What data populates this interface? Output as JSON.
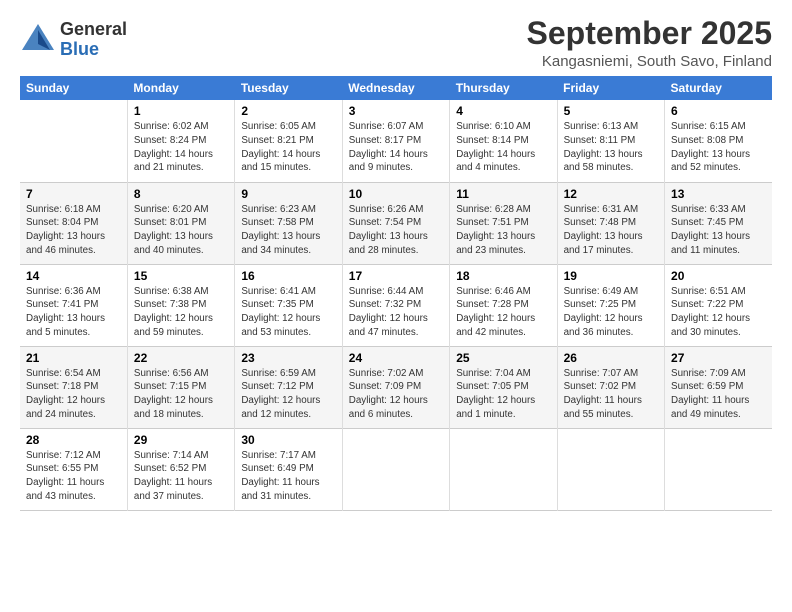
{
  "logo": {
    "general": "General",
    "blue": "Blue"
  },
  "title": "September 2025",
  "location": "Kangasniemi, South Savo, Finland",
  "days_header": [
    "Sunday",
    "Monday",
    "Tuesday",
    "Wednesday",
    "Thursday",
    "Friday",
    "Saturday"
  ],
  "weeks": [
    [
      {
        "num": "",
        "info": ""
      },
      {
        "num": "1",
        "info": "Sunrise: 6:02 AM\nSunset: 8:24 PM\nDaylight: 14 hours\nand 21 minutes."
      },
      {
        "num": "2",
        "info": "Sunrise: 6:05 AM\nSunset: 8:21 PM\nDaylight: 14 hours\nand 15 minutes."
      },
      {
        "num": "3",
        "info": "Sunrise: 6:07 AM\nSunset: 8:17 PM\nDaylight: 14 hours\nand 9 minutes."
      },
      {
        "num": "4",
        "info": "Sunrise: 6:10 AM\nSunset: 8:14 PM\nDaylight: 14 hours\nand 4 minutes."
      },
      {
        "num": "5",
        "info": "Sunrise: 6:13 AM\nSunset: 8:11 PM\nDaylight: 13 hours\nand 58 minutes."
      },
      {
        "num": "6",
        "info": "Sunrise: 6:15 AM\nSunset: 8:08 PM\nDaylight: 13 hours\nand 52 minutes."
      }
    ],
    [
      {
        "num": "7",
        "info": "Sunrise: 6:18 AM\nSunset: 8:04 PM\nDaylight: 13 hours\nand 46 minutes."
      },
      {
        "num": "8",
        "info": "Sunrise: 6:20 AM\nSunset: 8:01 PM\nDaylight: 13 hours\nand 40 minutes."
      },
      {
        "num": "9",
        "info": "Sunrise: 6:23 AM\nSunset: 7:58 PM\nDaylight: 13 hours\nand 34 minutes."
      },
      {
        "num": "10",
        "info": "Sunrise: 6:26 AM\nSunset: 7:54 PM\nDaylight: 13 hours\nand 28 minutes."
      },
      {
        "num": "11",
        "info": "Sunrise: 6:28 AM\nSunset: 7:51 PM\nDaylight: 13 hours\nand 23 minutes."
      },
      {
        "num": "12",
        "info": "Sunrise: 6:31 AM\nSunset: 7:48 PM\nDaylight: 13 hours\nand 17 minutes."
      },
      {
        "num": "13",
        "info": "Sunrise: 6:33 AM\nSunset: 7:45 PM\nDaylight: 13 hours\nand 11 minutes."
      }
    ],
    [
      {
        "num": "14",
        "info": "Sunrise: 6:36 AM\nSunset: 7:41 PM\nDaylight: 13 hours\nand 5 minutes."
      },
      {
        "num": "15",
        "info": "Sunrise: 6:38 AM\nSunset: 7:38 PM\nDaylight: 12 hours\nand 59 minutes."
      },
      {
        "num": "16",
        "info": "Sunrise: 6:41 AM\nSunset: 7:35 PM\nDaylight: 12 hours\nand 53 minutes."
      },
      {
        "num": "17",
        "info": "Sunrise: 6:44 AM\nSunset: 7:32 PM\nDaylight: 12 hours\nand 47 minutes."
      },
      {
        "num": "18",
        "info": "Sunrise: 6:46 AM\nSunset: 7:28 PM\nDaylight: 12 hours\nand 42 minutes."
      },
      {
        "num": "19",
        "info": "Sunrise: 6:49 AM\nSunset: 7:25 PM\nDaylight: 12 hours\nand 36 minutes."
      },
      {
        "num": "20",
        "info": "Sunrise: 6:51 AM\nSunset: 7:22 PM\nDaylight: 12 hours\nand 30 minutes."
      }
    ],
    [
      {
        "num": "21",
        "info": "Sunrise: 6:54 AM\nSunset: 7:18 PM\nDaylight: 12 hours\nand 24 minutes."
      },
      {
        "num": "22",
        "info": "Sunrise: 6:56 AM\nSunset: 7:15 PM\nDaylight: 12 hours\nand 18 minutes."
      },
      {
        "num": "23",
        "info": "Sunrise: 6:59 AM\nSunset: 7:12 PM\nDaylight: 12 hours\nand 12 minutes."
      },
      {
        "num": "24",
        "info": "Sunrise: 7:02 AM\nSunset: 7:09 PM\nDaylight: 12 hours\nand 6 minutes."
      },
      {
        "num": "25",
        "info": "Sunrise: 7:04 AM\nSunset: 7:05 PM\nDaylight: 12 hours\nand 1 minute."
      },
      {
        "num": "26",
        "info": "Sunrise: 7:07 AM\nSunset: 7:02 PM\nDaylight: 11 hours\nand 55 minutes."
      },
      {
        "num": "27",
        "info": "Sunrise: 7:09 AM\nSunset: 6:59 PM\nDaylight: 11 hours\nand 49 minutes."
      }
    ],
    [
      {
        "num": "28",
        "info": "Sunrise: 7:12 AM\nSunset: 6:55 PM\nDaylight: 11 hours\nand 43 minutes."
      },
      {
        "num": "29",
        "info": "Sunrise: 7:14 AM\nSunset: 6:52 PM\nDaylight: 11 hours\nand 37 minutes."
      },
      {
        "num": "30",
        "info": "Sunrise: 7:17 AM\nSunset: 6:49 PM\nDaylight: 11 hours\nand 31 minutes."
      },
      {
        "num": "",
        "info": ""
      },
      {
        "num": "",
        "info": ""
      },
      {
        "num": "",
        "info": ""
      },
      {
        "num": "",
        "info": ""
      }
    ]
  ]
}
